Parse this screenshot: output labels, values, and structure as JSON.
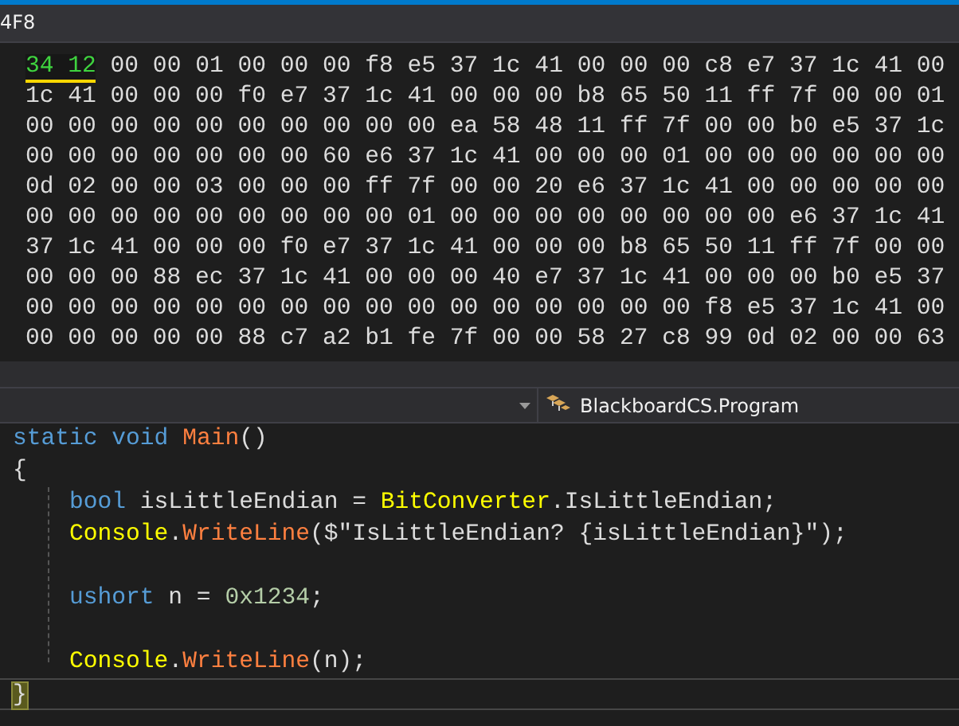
{
  "memory_window": {
    "address": "4F8",
    "rows": [
      {
        "changed": "34 12",
        "bytes": "00 00 01 00 00 00 f8 e5 37 1c 41 00 00 00 c8 e7 37 1c 41 00"
      },
      {
        "bytes": "1c 41 00 00 00 f0 e7 37 1c 41 00 00 00 b8 65 50 11 ff 7f 00 00 01"
      },
      {
        "bytes": "00 00 00 00 00 00 00 00 00 00 ea 58 48 11 ff 7f 00 00 b0 e5 37 1c"
      },
      {
        "bytes": "00 00 00 00 00 00 00 60 e6 37 1c 41 00 00 00 01 00 00 00 00 00 00"
      },
      {
        "bytes": "0d 02 00 00 03 00 00 00 ff 7f 00 00 20 e6 37 1c 41 00 00 00 00 00"
      },
      {
        "bytes": "00 00 00 00 00 00 00 00 00 01 00 00 00 00 00 00 00 00 e6 37 1c 41"
      },
      {
        "bytes": "37 1c 41 00 00 00 f0 e7 37 1c 41 00 00 00 b8 65 50 11 ff 7f 00 00"
      },
      {
        "bytes": "00 00 00 88 ec 37 1c 41 00 00 00 40 e7 37 1c 41 00 00 00 b0 e5 37"
      },
      {
        "bytes": "00 00 00 00 00 00 00 00 00 00 00 00 00 00 00 00 f8 e5 37 1c 41 00"
      },
      {
        "bytes": "00 00 00 00 00 88 c7 a2 b1 fe 7f 00 00 58 27 c8 99 0d 02 00 00 63"
      }
    ]
  },
  "editor": {
    "type_dropdown": "BlackboardCS.Program",
    "lines": [
      {
        "tokens": [
          {
            "kind": "keyword",
            "text": "static void "
          },
          {
            "kind": "method",
            "text": "Main"
          },
          {
            "kind": "plain",
            "text": "()"
          }
        ]
      },
      {
        "tokens": [
          {
            "kind": "plain",
            "text": "{"
          }
        ],
        "children": [
          {
            "tokens": [
              {
                "kind": "keyword",
                "text": "bool"
              },
              {
                "kind": "plain",
                "text": " isLittleEndian = "
              },
              {
                "kind": "class",
                "text": "BitConverter"
              },
              {
                "kind": "plain",
                "text": ".IsLittleEndian;"
              }
            ]
          },
          {
            "tokens": [
              {
                "kind": "class",
                "text": "Console"
              },
              {
                "kind": "plain",
                "text": "."
              },
              {
                "kind": "method",
                "text": "WriteLine"
              },
              {
                "kind": "plain",
                "text": "($\"IsLittleEndian? {isLittleEndian}\");"
              }
            ]
          },
          {
            "blank_line_before": true,
            "tokens": [
              {
                "kind": "keyword",
                "text": "ushort"
              },
              {
                "kind": "plain",
                "text": " n = "
              },
              {
                "kind": "number",
                "text": "0x1234"
              },
              {
                "kind": "plain",
                "text": ";"
              }
            ]
          },
          {
            "blank_line_before": true,
            "tokens": [
              {
                "kind": "class",
                "text": "Console"
              },
              {
                "kind": "plain",
                "text": "."
              },
              {
                "kind": "method",
                "text": "WriteLine"
              },
              {
                "kind": "plain",
                "text": "(n);"
              }
            ]
          }
        ]
      },
      {
        "current": true,
        "tokens": [
          {
            "kind": "brace-match",
            "text": "}"
          }
        ]
      }
    ]
  }
}
